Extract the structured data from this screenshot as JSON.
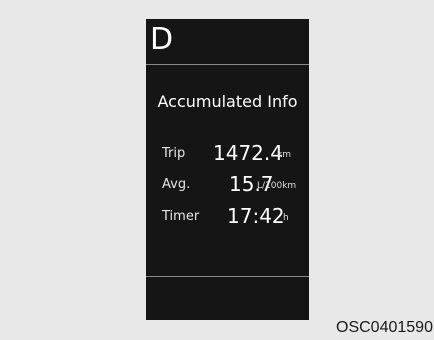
{
  "display": {
    "gear": "D",
    "title": "Accumulated Info",
    "rows": [
      {
        "label": "Trip",
        "value": "1472.4",
        "unit": "km"
      },
      {
        "label": "Avg.",
        "value": "15.7",
        "unit": "L/100km"
      },
      {
        "label": "Timer",
        "value": "17:42",
        "unit": "h"
      }
    ]
  },
  "figure_code": "OSC0401590",
  "colors": {
    "panel": "#151515",
    "background": "#e8e8e8",
    "text": "#ffffff",
    "divider": "#8a8a8a"
  }
}
